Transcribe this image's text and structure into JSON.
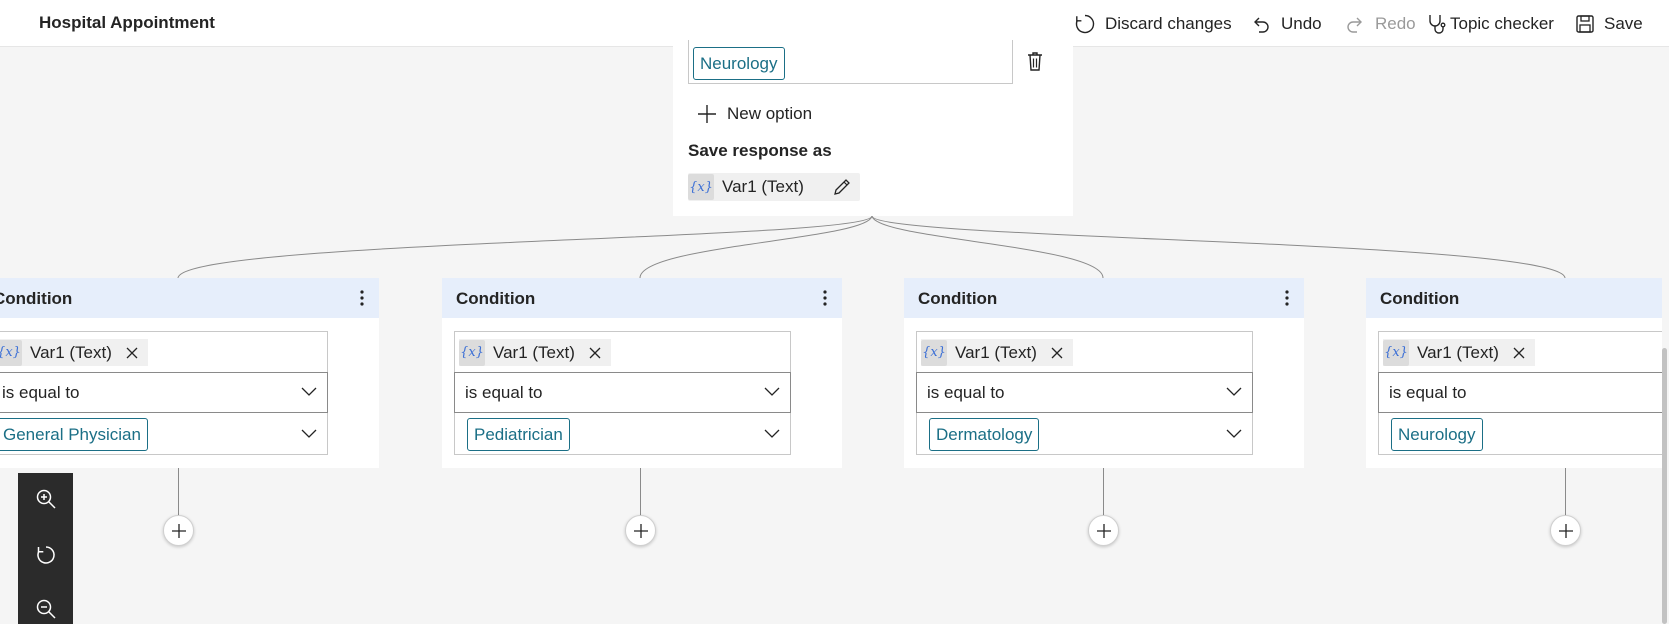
{
  "header": {
    "title": "Hospital Appointment",
    "discard_label": "Discard changes",
    "undo_label": "Undo",
    "redo_label": "Redo",
    "topic_checker_label": "Topic checker",
    "save_label": "Save"
  },
  "question_node": {
    "last_option": "Neurology",
    "new_option_label": "New option",
    "save_response_label": "Save response as",
    "variable_badge": "{x}",
    "variable": "Var1 (Text)"
  },
  "conditions": [
    {
      "title": "Condition",
      "variable_badge": "{x}",
      "variable": "Var1 (Text)",
      "operator": "is equal to",
      "value": "General Physician"
    },
    {
      "title": "Condition",
      "variable_badge": "{x}",
      "variable": "Var1 (Text)",
      "operator": "is equal to",
      "value": "Pediatrician"
    },
    {
      "title": "Condition",
      "variable_badge": "{x}",
      "variable": "Var1 (Text)",
      "operator": "is equal to",
      "value": "Dermatology"
    },
    {
      "title": "Condition",
      "variable_badge": "{x}",
      "variable": "Var1 (Text)",
      "operator": "is equal to",
      "value": "Neurology"
    }
  ],
  "zoom_toolbar": {
    "icons": [
      "zoom-in-icon",
      "reset-view-icon",
      "zoom-out-icon"
    ]
  },
  "colors": {
    "accent_chip": "#1b6f86",
    "card_header": "#e6eefb",
    "variable_icon": "#3b6fd6",
    "zoom_toolbar_bg": "#2b2b2b"
  }
}
